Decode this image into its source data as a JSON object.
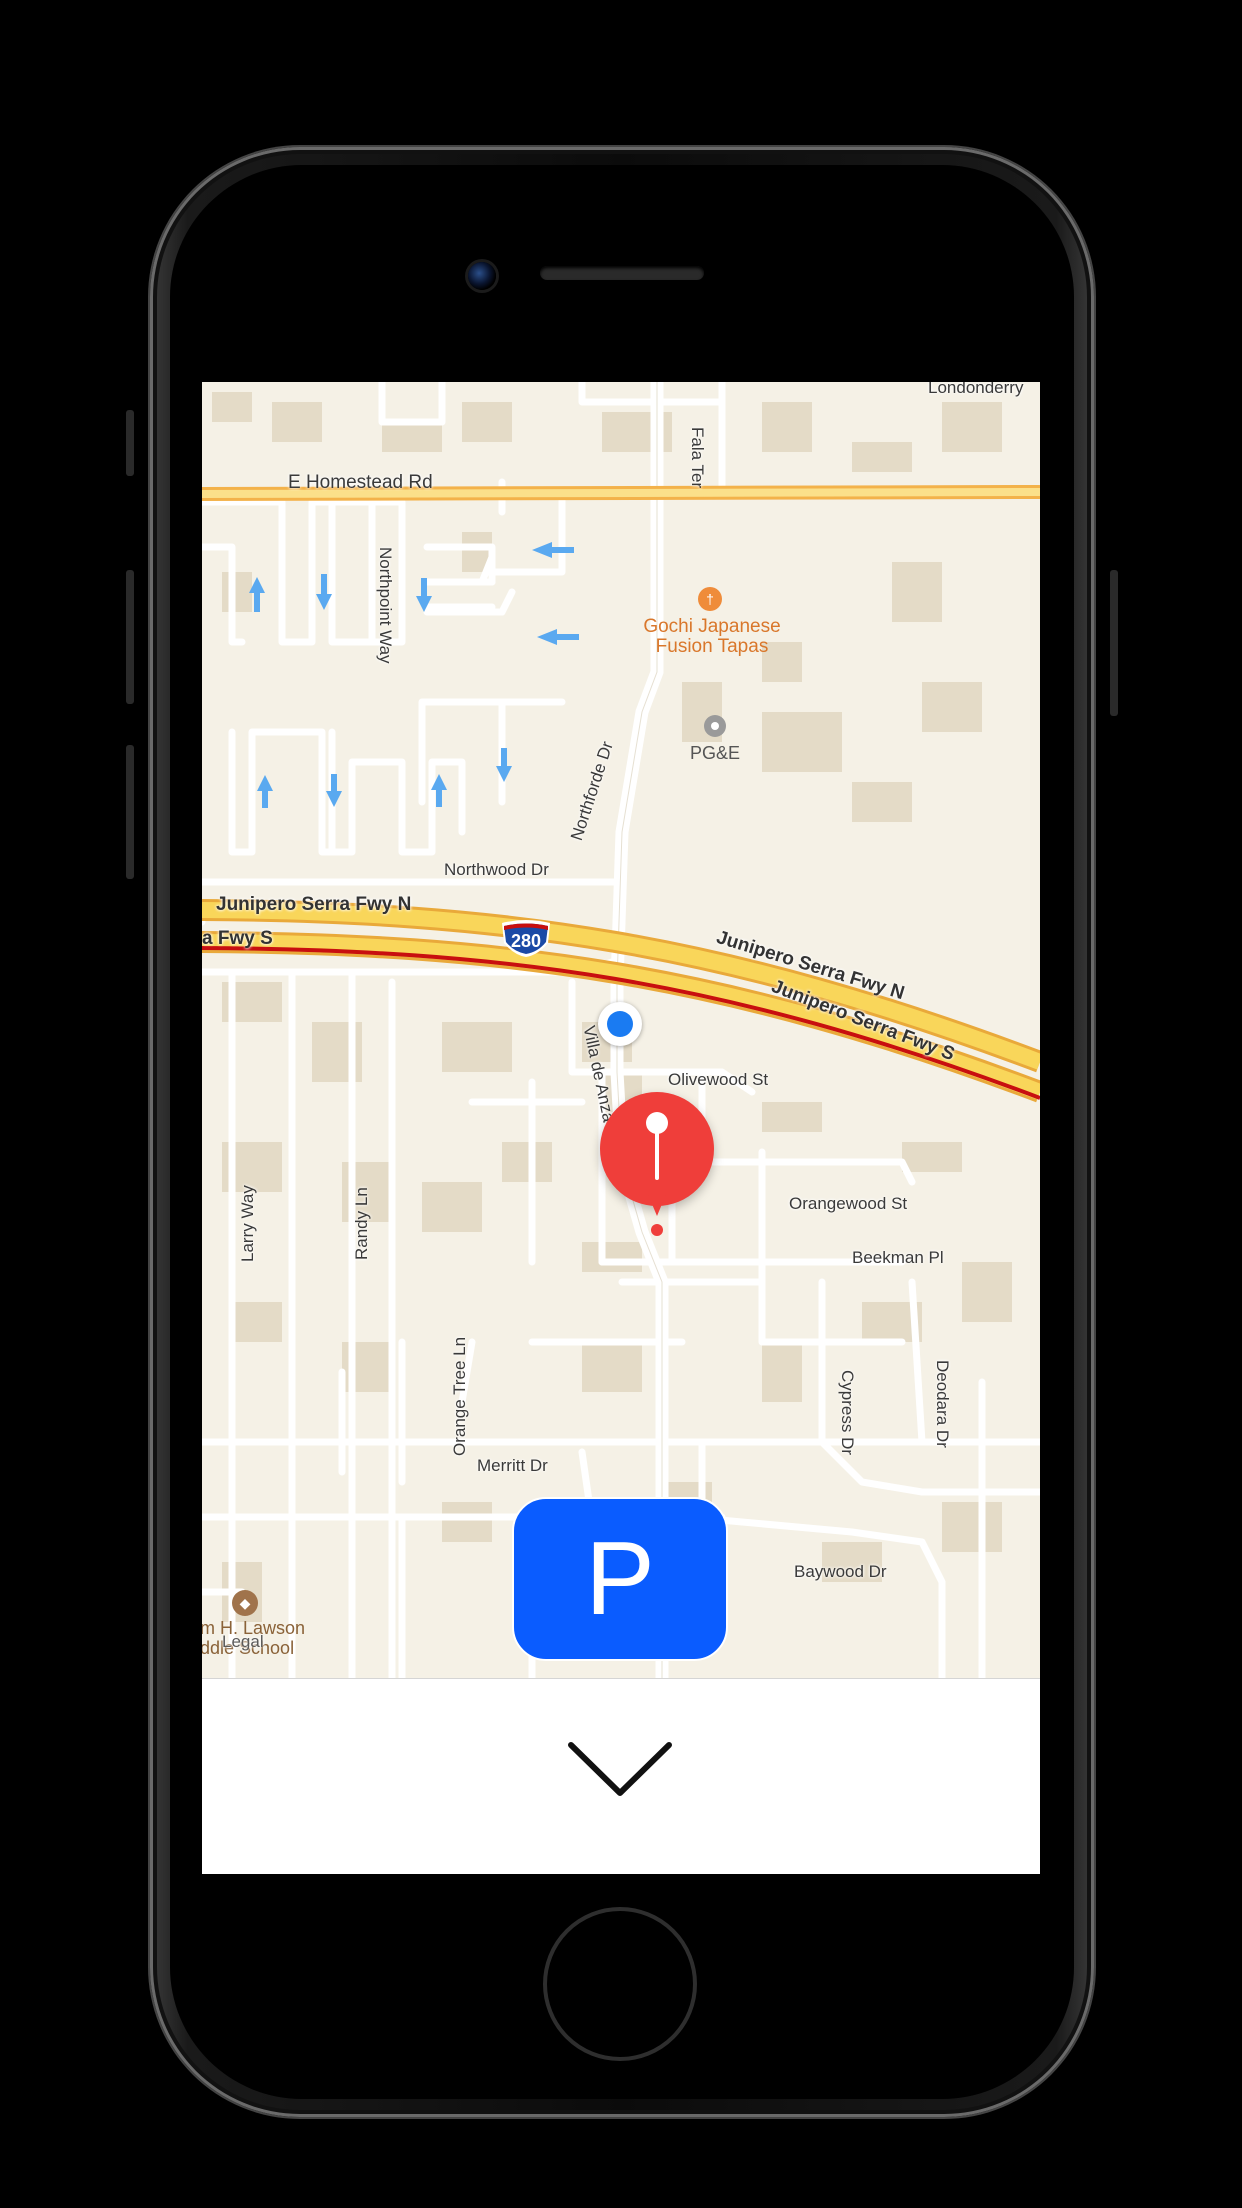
{
  "map": {
    "streets": {
      "homestead": "E Homestead Rd",
      "northpoint": "Northpoint Way",
      "northforde": "Northforde Dr",
      "northwood": "Northwood Dr",
      "fala": "Fala Ter",
      "londonderry": "Londonderry",
      "junipero_n_left": "Junipero Serra Fwy N",
      "junipero_s_left": "a Fwy S",
      "junipero_n_right": "Junipero Serra Fwy N",
      "junipero_s_right": "Junipero Serra Fwy S",
      "villa": "Villa de Anza Ave",
      "olivewood": "Olivewood St",
      "orangewood": "Orangewood St",
      "beekman": "Beekman Pl",
      "larry": "Larry Way",
      "randy": "Randy Ln",
      "orange_tree": "Orange Tree Ln",
      "cypress": "Cypress Dr",
      "deodara": "Deodara Dr",
      "merritt": "Merritt Dr",
      "baywood": "Baywood Dr"
    },
    "highway_shield": "280",
    "pois": {
      "restaurant": "Gochi Japanese\nFusion Tapas",
      "utility": "PG&E",
      "school": "m H. Lawson\nddle School",
      "legal": "Legal"
    }
  },
  "parking_button": {
    "label": "P"
  },
  "colors": {
    "map_bg": "#f5f1e6",
    "block": "#ece4d2",
    "building": "#e4dbc7",
    "highway": "#f9d65a",
    "highway_edge": "#e9a93a",
    "road_red": "#c80f0f",
    "user_dot": "#1a7bf2",
    "pin": "#ef3e3a",
    "parking_button": "#0a5cff"
  },
  "icons": {
    "restaurant": "fork-knife-icon",
    "utility": "circle-dot-icon",
    "school": "graduation-cap-icon",
    "dismiss": "chevron-down-icon"
  }
}
